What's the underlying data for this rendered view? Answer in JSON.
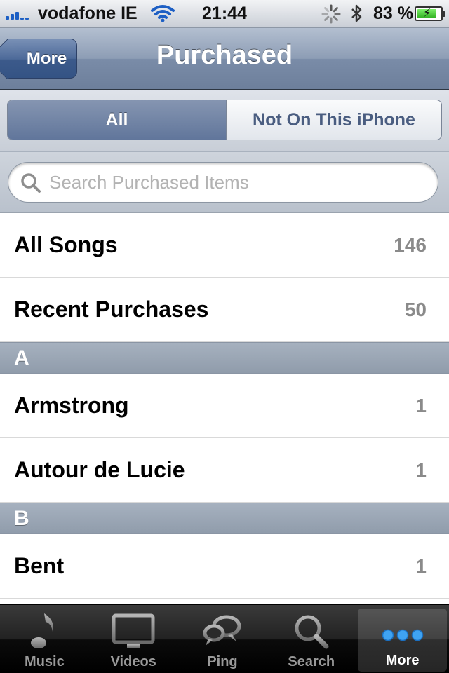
{
  "status_bar": {
    "carrier": "vodafone IE",
    "time": "21:44",
    "battery": "83 %",
    "battery_level": 0.83
  },
  "nav": {
    "back_label": "More",
    "title": "Purchased"
  },
  "segments": {
    "all": "All",
    "not_on_device": "Not On This iPhone"
  },
  "search": {
    "placeholder": "Search Purchased Items",
    "value": ""
  },
  "list": {
    "top_rows": [
      {
        "label": "All Songs",
        "count": "146"
      },
      {
        "label": "Recent Purchases",
        "count": "50"
      }
    ],
    "sections": [
      {
        "header": "A",
        "rows": [
          {
            "label": "Armstrong",
            "count": "1"
          },
          {
            "label": "Autour de Lucie",
            "count": "1"
          }
        ]
      },
      {
        "header": "B",
        "rows": [
          {
            "label": "Bent",
            "count": "1"
          }
        ]
      }
    ]
  },
  "tab_bar": {
    "tabs": [
      {
        "label": "Music",
        "icon": "music-note-icon"
      },
      {
        "label": "Videos",
        "icon": "tv-icon"
      },
      {
        "label": "Ping",
        "icon": "ping-bubbles-icon"
      },
      {
        "label": "Search",
        "icon": "magnifier-icon"
      },
      {
        "label": "More",
        "icon": "more-dots-icon"
      }
    ],
    "active": "More"
  },
  "colors": {
    "nav_blue": "#6d7f9b",
    "segment_active": "#61769b",
    "count_gray": "#8a8a8a",
    "tab_bar": "#111111"
  }
}
